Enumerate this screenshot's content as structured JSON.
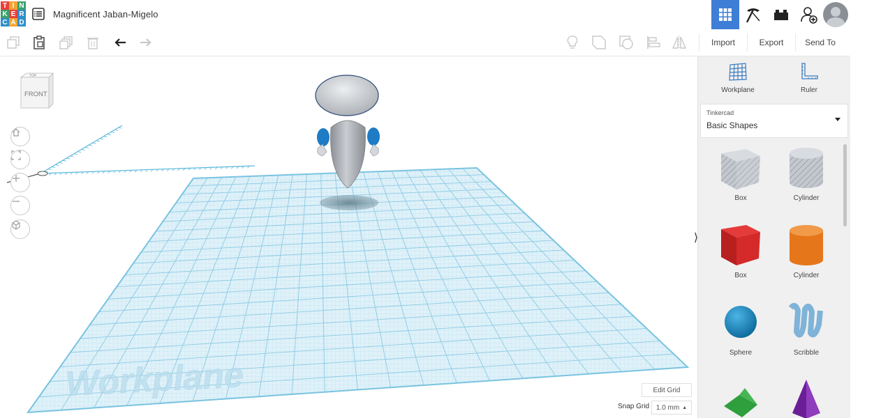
{
  "header": {
    "logo_letters": [
      "T",
      "I",
      "N",
      "K",
      "E",
      "R",
      "C",
      "A",
      "D"
    ],
    "logo_colors": [
      "#e8403a",
      "#f2a330",
      "#3ca06a",
      "#3ca06a",
      "#e8403a",
      "#2d8ecb",
      "#2d8ecb",
      "#f2a330",
      "#2d8ecb"
    ],
    "title": "Magnificent Jaban-Migelo",
    "icons": [
      "grid-view-icon",
      "pickaxe-icon",
      "brick-icon",
      "add-user-icon"
    ]
  },
  "toolbar": {
    "left_icons": [
      "copy-icon",
      "paste-icon",
      "duplicate-icon",
      "delete-icon",
      "undo-icon",
      "redo-icon"
    ],
    "right_icons": [
      "light-bulb-icon",
      "shape-icon",
      "group-icon",
      "align-icon",
      "mirror-icon"
    ],
    "import_label": "Import",
    "export_label": "Export",
    "send_label": "Send To"
  },
  "viewport": {
    "viewcube_top": "TOP",
    "viewcube_front": "FRONT",
    "workplane_text": "Workplane",
    "edit_grid_label": "Edit Grid",
    "snap_grid_label": "Snap Grid",
    "snap_grid_value": "1.0 mm",
    "nav_buttons": [
      "home-icon",
      "fit-icon",
      "zoom-in-icon",
      "zoom-out-icon",
      "perspective-icon"
    ]
  },
  "panel": {
    "workplane_label": "Workplane",
    "ruler_label": "Ruler",
    "library_source": "Tinkercad",
    "library_name": "Basic Shapes",
    "shapes": [
      {
        "label": "Box",
        "color": "#b8bec6",
        "kind": "box-hole"
      },
      {
        "label": "Cylinder",
        "color": "#b8bec6",
        "kind": "cyl-hole"
      },
      {
        "label": "Box",
        "color": "#d42a2a",
        "kind": "box"
      },
      {
        "label": "Cylinder",
        "color": "#e5761a",
        "kind": "cyl"
      },
      {
        "label": "Sphere",
        "color": "#1d8fc4",
        "kind": "sphere"
      },
      {
        "label": "Scribble",
        "color": "#7fb3d8",
        "kind": "scribble"
      },
      {
        "label": "",
        "color": "#2f9e3c",
        "kind": "roof"
      },
      {
        "label": "",
        "color": "#7d2aa8",
        "kind": "pyramid"
      }
    ]
  }
}
